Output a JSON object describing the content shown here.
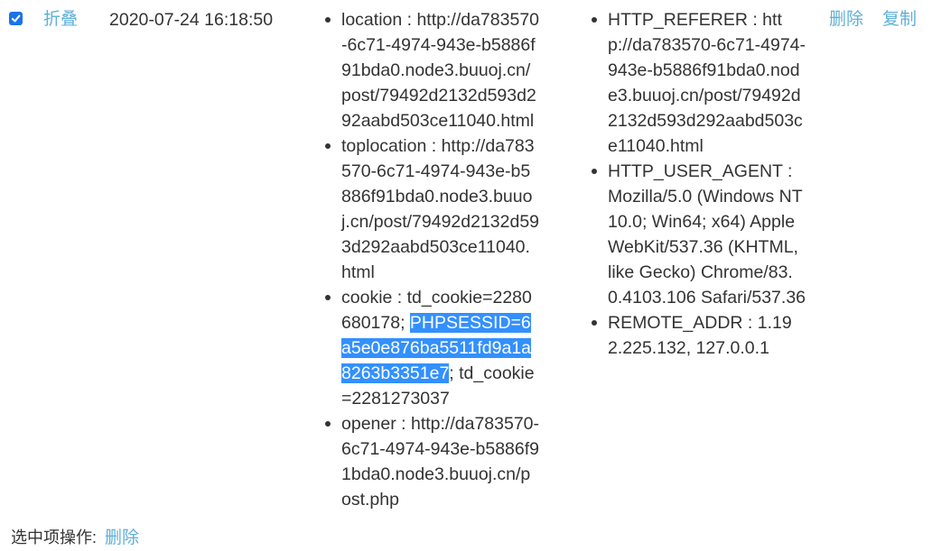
{
  "row": {
    "checked": true,
    "collapse_label": "折叠",
    "timestamp": "2020-07-24 16:18:50",
    "request_params": [
      {
        "text": "location : http://da783570-6c71-4974-943e-b5886f91bda0.node3.buuoj.cn/post/79492d2132d593d292aabd503ce11040.html",
        "lines": [
          "location : http://da783570",
          "-6c71-4974-943e-b5886f",
          "91bda0.node3.buuoj.cn/",
          "post/79492d2132d593d2",
          "92aabd503ce11040.html"
        ]
      },
      {
        "text": "toplocation : http://da783570-6c71-4974-943e-b5886f91bda0.node3.buuoj.cn/post/79492d2132d593d292aabd503ce11040.html",
        "lines": [
          "toplocation : http://da783",
          "570-6c71-4974-943e-b5",
          "886f91bda0.node3.buuo",
          "j.cn/post/79492d2132d59",
          "3d292aabd503ce11040.",
          "html"
        ]
      },
      {
        "text": "cookie : td_cookie=2280680178; PHPSESSID=6a5e0e876ba5511fd9a1a8263b3351e7; td_cookie=2281273037",
        "line1": "cookie : td_cookie=2280",
        "line2_pre": "680178; ",
        "selected_parts": [
          "PHPSESSID=6",
          "a5e0e876ba5511fd9a1a",
          "8263b3351e7"
        ],
        "line4_post": "; td_cookie",
        "line5": "=2281273037"
      },
      {
        "text": "opener : http://da783570-6c71-4974-943e-b5886f91bda0.node3.buuoj.cn/post.php",
        "lines": [
          "opener : http://da783570-",
          "6c71-4974-943e-b5886f9",
          "1bda0.node3.buuoj.cn/p",
          "ost.php"
        ]
      }
    ],
    "server_params": [
      {
        "text": "HTTP_REFERER : http://da783570-6c71-4974-943e-b5886f91bda0.node3.buuoj.cn/post/79492d2132d593d292aabd503ce11040.html",
        "lines": [
          "HTTP_REFERER : htt",
          "p://da783570-6c71-4974-",
          "943e-b5886f91bda0.nod",
          "e3.buuoj.cn/post/79492d",
          "2132d593d292aabd503c",
          "e11040.html"
        ]
      },
      {
        "text": "HTTP_USER_AGENT : Mozilla/5.0 (Windows NT 10.0; Win64; x64) AppleWebKit/537.36 (KHTML, like Gecko) Chrome/83.0.4103.106 Safari/537.36",
        "lines": [
          "HTTP_USER_AGENT :",
          "Mozilla/5.0 (Windows NT",
          "10.0; Win64; x64) Apple",
          "WebKit/537.36 (KHTML,",
          "like Gecko) Chrome/83.",
          "0.4103.106 Safari/537.36"
        ]
      },
      {
        "text": "REMOTE_ADDR : 1.192.225.132, 127.0.0.1",
        "lines": [
          "REMOTE_ADDR : 1.19",
          "2.225.132, 127.0.0.1"
        ]
      }
    ],
    "delete_label": "删除",
    "copy_label": "复制"
  },
  "footer": {
    "label": "选中项操作:",
    "delete_label": "删除"
  },
  "colors": {
    "link": "#5fb0d9",
    "text": "#333333",
    "selection": "#3390ff",
    "checkbox": "#1a73e8"
  }
}
